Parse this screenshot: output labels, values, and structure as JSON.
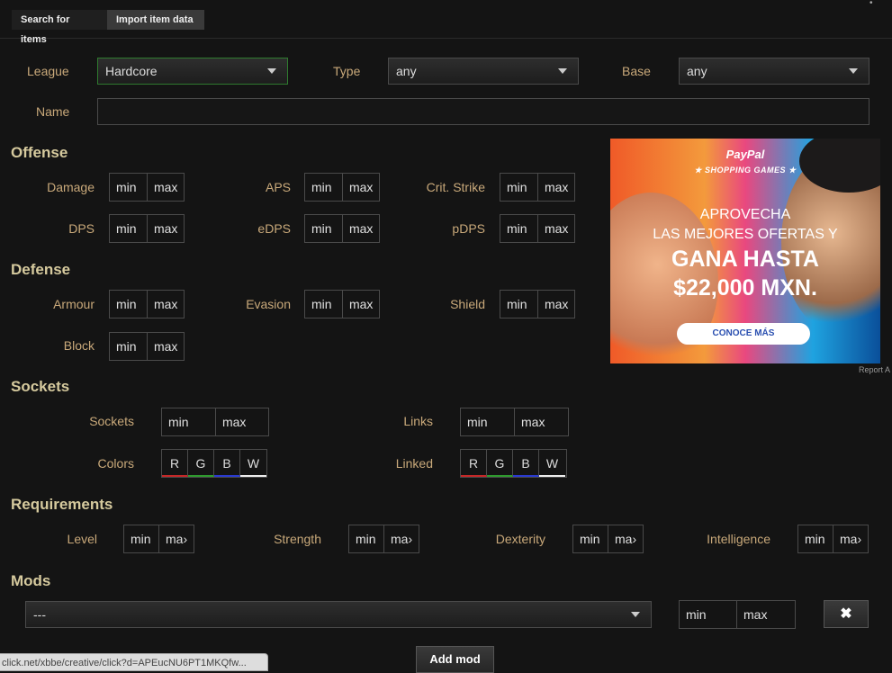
{
  "tabs": [
    {
      "label": "Search for items",
      "active": false
    },
    {
      "label": "Import item data",
      "active": true
    }
  ],
  "filters": {
    "league": {
      "label": "League",
      "value": "Hardcore"
    },
    "type": {
      "label": "Type",
      "value": "any"
    },
    "base": {
      "label": "Base",
      "value": "any"
    },
    "name": {
      "label": "Name",
      "value": ""
    }
  },
  "minmax": {
    "min": "min",
    "max": "max",
    "max_clipped": "ma›"
  },
  "offense": {
    "title": "Offense",
    "fields": [
      "Damage",
      "APS",
      "Crit. Strike",
      "DPS",
      "eDPS",
      "pDPS"
    ]
  },
  "defense": {
    "title": "Defense",
    "fields": [
      "Armour",
      "Evasion",
      "Shield",
      "Block"
    ]
  },
  "sockets": {
    "title": "Sockets",
    "sockets_label": "Sockets",
    "links_label": "Links",
    "colors_label": "Colors",
    "linked_label": "Linked",
    "colors": [
      "R",
      "G",
      "B",
      "W"
    ]
  },
  "requirements": {
    "title": "Requirements",
    "fields": [
      "Level",
      "Strength",
      "Dexterity",
      "Intelligence"
    ]
  },
  "mods": {
    "title": "Mods",
    "select_value": "---",
    "remove_icon": "✖",
    "add_label": "Add mod"
  },
  "ad": {
    "brand": "PayPal",
    "subtitle": "★ SHOPPING GAMES ★",
    "line1": "APROVECHA",
    "line2": "LAS MEJORES OFERTAS Y",
    "line3": "GANA HASTA",
    "line4": "$22,000 MXN.",
    "cta": "CONOCE MÁS",
    "report": "Report A"
  },
  "status_url": "click.net/xbbe/creative/click?d=APEucNU6PT1MKQfw...",
  "colors": {
    "background": "#141414",
    "label": "#c9a97a",
    "section": "#d6ca9e",
    "league_border": "#2f7a2f"
  }
}
